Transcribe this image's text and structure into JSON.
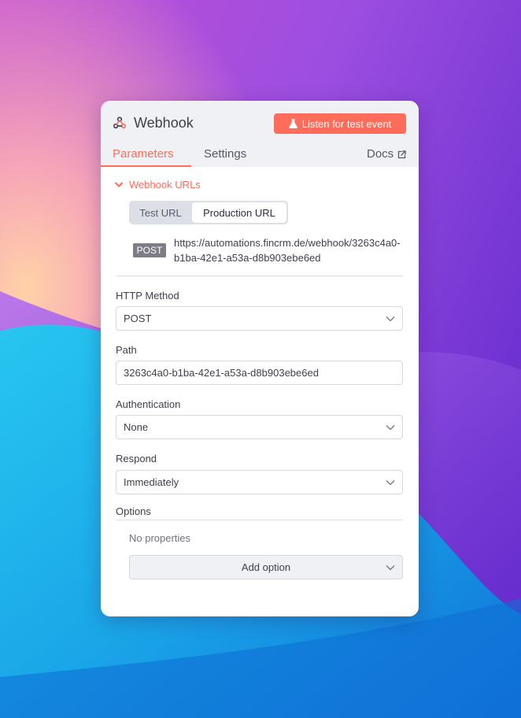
{
  "node": {
    "title": "Webhook",
    "icon": "webhook-icon",
    "listen_button": "Listen for test event",
    "listen_icon": "flask-icon"
  },
  "tabs": {
    "parameters": "Parameters",
    "settings": "Settings",
    "docs": "Docs",
    "docs_icon": "external-link-icon"
  },
  "webhook_urls": {
    "section_label": "Webhook URLs",
    "toggle": {
      "test": "Test URL",
      "production": "Production URL",
      "selected": "Production URL"
    },
    "method": "POST",
    "url": "https://automations.fincrm.de/webhook/3263c4a0-b1ba-42e1-a53a-d8b903ebe6ed"
  },
  "fields": {
    "http_method": {
      "label": "HTTP Method",
      "value": "POST"
    },
    "path": {
      "label": "Path",
      "value": "3263c4a0-b1ba-42e1-a53a-d8b903ebe6ed"
    },
    "authentication": {
      "label": "Authentication",
      "value": "None"
    },
    "respond": {
      "label": "Respond",
      "value": "Immediately"
    }
  },
  "options": {
    "label": "Options",
    "empty_text": "No properties",
    "add_button": "Add option"
  },
  "colors": {
    "accent": "#ff6d5a",
    "header_bg": "#f0f1f5",
    "badge_bg": "#7d7d87"
  }
}
